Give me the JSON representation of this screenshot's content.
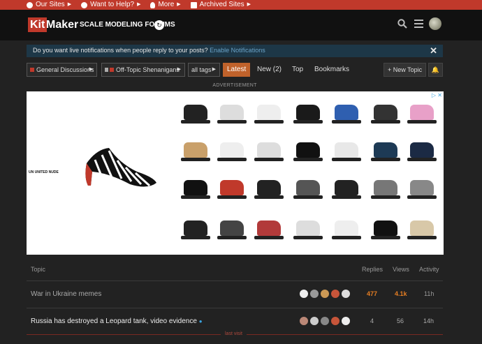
{
  "topbar": {
    "items": [
      {
        "label": "Our Sites",
        "icon": "globe-icon"
      },
      {
        "label": "Want to Help?",
        "icon": "help-icon"
      },
      {
        "label": "More",
        "icon": "lightbulb-icon"
      },
      {
        "label": "Archived Sites",
        "icon": "archive-icon"
      }
    ]
  },
  "header": {
    "logo_kit": "Kit",
    "logo_maker": "Maker",
    "site_title": "SCALE MODELING FORUMS"
  },
  "notification": {
    "text": "Do you want live notifications when people reply to your posts? ",
    "link": "Enable Notifications",
    "close": "✕"
  },
  "nav": {
    "category": "General Discussions",
    "subcategory": "Off-Topic Shenanigans",
    "tags": "all tags",
    "latest": "Latest",
    "new": "New (2)",
    "top": "Top",
    "bookmarks": "Bookmarks",
    "new_topic": "New Topic"
  },
  "ad": {
    "label": "ADVERTISEMENT",
    "brand": "UN UNITED NUDE",
    "badge": "▷ ✕"
  },
  "topic_list": {
    "headers": {
      "topic": "Topic",
      "replies": "Replies",
      "views": "Views",
      "activity": "Activity"
    },
    "rows": [
      {
        "title": "War in Ukraine memes",
        "replies": "477",
        "views": "4.1k",
        "activity": "11h"
      },
      {
        "title": "Russia has destroyed a Leopard tank, video evidence",
        "replies": "4",
        "views": "56",
        "activity": "14h"
      }
    ],
    "last_visit": "last visit"
  },
  "colors": {
    "accent": "#c0392b",
    "highlight": "#e67e22"
  }
}
